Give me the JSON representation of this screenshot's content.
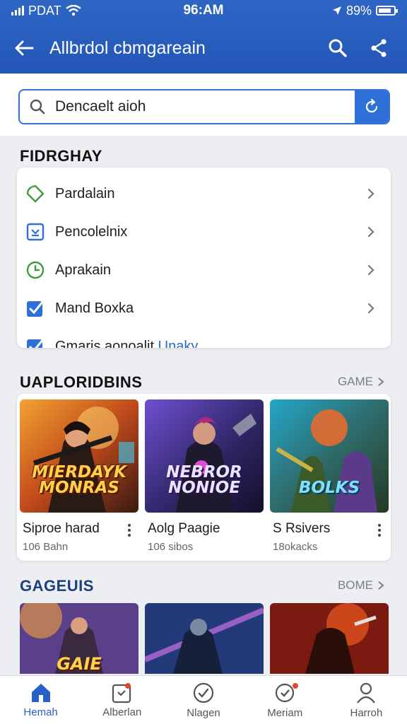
{
  "status_bar": {
    "carrier": "PDAT",
    "time": "96:AM",
    "battery": "89%"
  },
  "app_bar": {
    "title": "Allbrdol cbmgareain",
    "back_icon": "arrow-left-icon",
    "search_icon": "search-icon",
    "share_icon": "share-icon"
  },
  "search": {
    "value": "Dencaelt aioh",
    "placeholder": "Dencaelt aioh"
  },
  "section_list": {
    "title": "FIDRGHAY",
    "items": [
      {
        "label": "Pardalain",
        "icon": "tag-icon"
      },
      {
        "label": "Pencolelnix",
        "icon": "calendar-icon"
      },
      {
        "label": "Aprakain",
        "icon": "clock-icon"
      },
      {
        "label": "Mand Boxka",
        "icon": "checkbox-icon"
      },
      {
        "label": "Gmaris aonoalit",
        "accent": "Unaky",
        "icon": "checkbox-icon"
      }
    ]
  },
  "section_games": {
    "title": "UAPLORIDBINS",
    "more": "GAME",
    "games": [
      {
        "name": "Siproe harad",
        "meta": "106 Bahn",
        "logo": "MIERDAYK MONRAS"
      },
      {
        "name": "Aolg Paagie",
        "meta": "106 sibos",
        "logo": "NEBROR NONIOE"
      },
      {
        "name": "S Rsivers",
        "meta": "18okacks",
        "logo": "BOLKS"
      }
    ]
  },
  "section_more": {
    "title": "GAGEUIS",
    "more": "BOME",
    "logo": "GAIE"
  },
  "bottom_nav": [
    {
      "label": "Hemah",
      "icon": "home-icon"
    },
    {
      "label": "Alberlan",
      "icon": "card-icon"
    },
    {
      "label": "Nlagen",
      "icon": "compass-icon"
    },
    {
      "label": "Meriam",
      "icon": "badge-check-icon"
    },
    {
      "label": "Harroh",
      "icon": "person-icon"
    }
  ],
  "colors": {
    "primary": "#2f66c5",
    "accent": "#2a67d0",
    "background": "#eceef1",
    "badge": "#e2472f"
  }
}
